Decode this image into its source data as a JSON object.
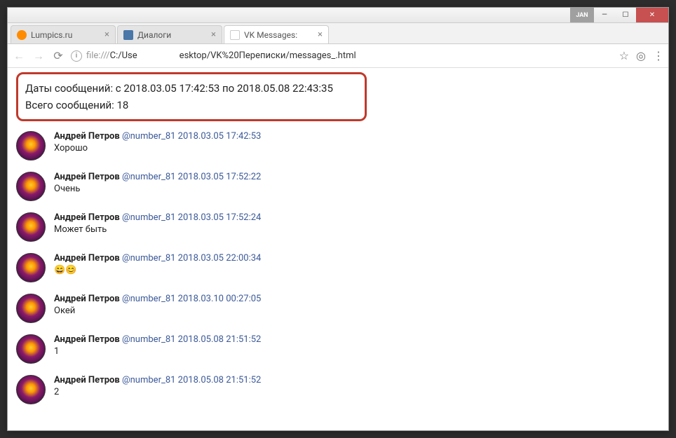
{
  "titlebar": {
    "jan_label": "JAN",
    "min": "—",
    "max": "☐",
    "close": "✕"
  },
  "tabs": [
    {
      "title": "Lumpics.ru",
      "favicon_color": "#ff8c00"
    },
    {
      "title": "Диалоги",
      "favicon_color": "#4a76a8"
    },
    {
      "title": "VK Messages:",
      "favicon_color": "#ddd",
      "active": true
    }
  ],
  "newtab": "",
  "urlbar": {
    "info_badge": "i",
    "protocol": "file:///",
    "path_visible_left": "C:/Usе",
    "path_visible_right": "esktop/VK%20Переписки/messages_.html",
    "star": "☆",
    "ext": "◎",
    "menu": "⋮"
  },
  "header": {
    "dates_label": "Даты сообщений: с 2018.03.05 17:42:53 по 2018.05.08 22:43:35",
    "total_label": "Всего сообщений: 18"
  },
  "messages": [
    {
      "name": "Андрей Петров",
      "handle": "@number_81",
      "ts": "2018.03.05 17:42:53",
      "text": "Хорошо"
    },
    {
      "name": "Андрей Петров",
      "handle": "@number_81",
      "ts": "2018.03.05 17:52:22",
      "text": "Очень"
    },
    {
      "name": "Андрей Петров",
      "handle": "@number_81",
      "ts": "2018.03.05 17:52:24",
      "text": "Может быть"
    },
    {
      "name": "Андрей Петров",
      "handle": "@number_81",
      "ts": "2018.03.05 22:00:34",
      "text": "😄😊"
    },
    {
      "name": "Андрей Петров",
      "handle": "@number_81",
      "ts": "2018.03.10 00:27:05",
      "text": "Окей"
    },
    {
      "name": "Андрей Петров",
      "handle": "@number_81",
      "ts": "2018.05.08 21:51:52",
      "text": "1"
    },
    {
      "name": "Андрей Петров",
      "handle": "@number_81",
      "ts": "2018.05.08 21:51:52",
      "text": "2"
    }
  ]
}
